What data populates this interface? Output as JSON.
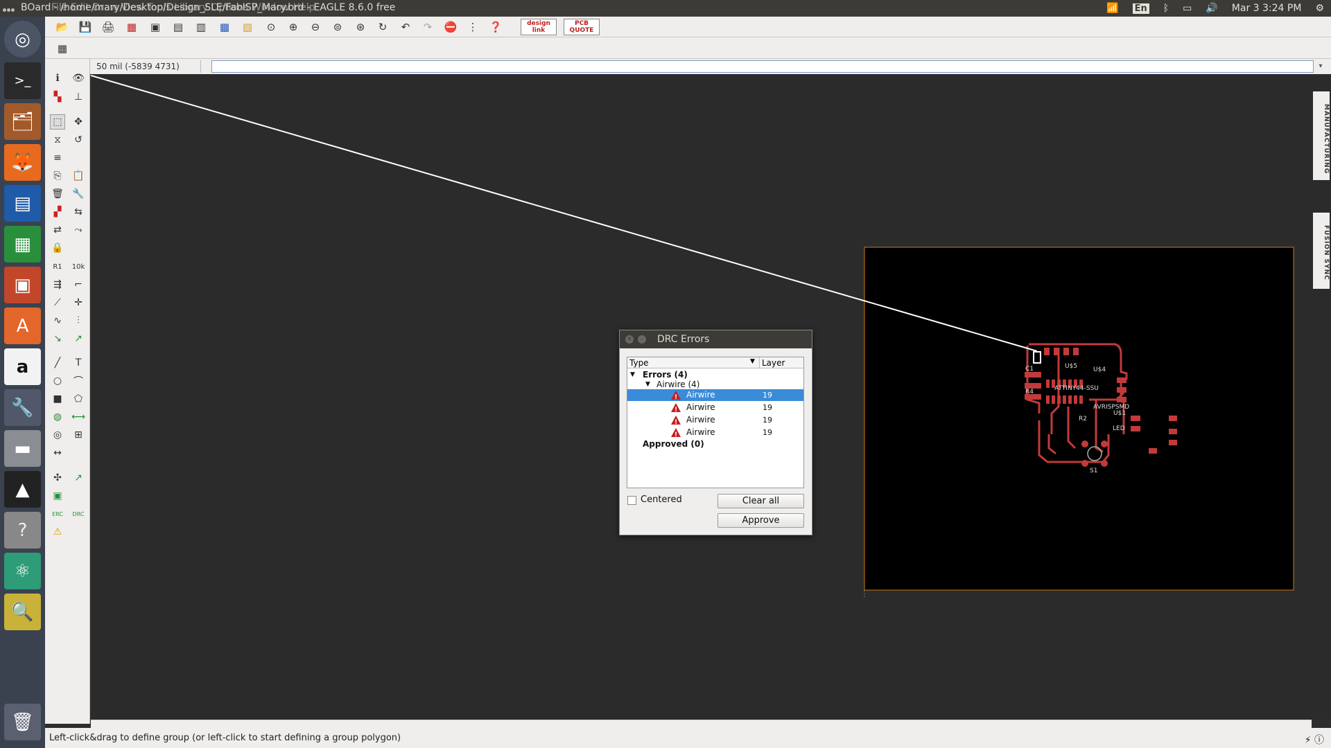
{
  "topbar": {
    "title": "BOard - /home/mary/Desktop/Design_SLE/FabISP_Mary.brd - EAGLE 8.6.0 free",
    "menus": "File  Edit  Draw  View  Tools  Library  Options  Window  Help",
    "tray": {
      "wifi_icon": "wifi-icon",
      "lang": "En",
      "bluetooth_icon": "bluetooth-icon",
      "battery_icon": "battery-icon",
      "volume_icon": "volume-icon",
      "datetime": "Mar 3  3:24 PM",
      "settings_icon": "gear-icon"
    }
  },
  "launcher": {
    "items": [
      "ubuntu-dash-icon",
      "terminal-icon",
      "files-icon",
      "firefox-icon",
      "writer-icon",
      "calc-icon",
      "impress-icon",
      "software-center-icon",
      "amazon-icon",
      "system-settings-icon",
      "disk-icon",
      "inkscape-icon",
      "help-icon",
      "atom-icon",
      "image-viewer-icon",
      "trash-icon"
    ]
  },
  "toolbar": {
    "design_link_label": "design link",
    "pcb_quote_label": "PCB QUOTE"
  },
  "command": {
    "coords": "50 mil (-5839 4731)",
    "input_value": ""
  },
  "right_tabs": {
    "manufacturing": "MANUFACTURING",
    "fusion_sync": "FUSION SYNC"
  },
  "status": {
    "message": "Left-click&drag to define group (or left-click to start defining a group polygon)"
  },
  "drc": {
    "title": "DRC Errors",
    "col_type": "Type",
    "col_layer": "Layer",
    "errors_label": "Errors (4)",
    "airwire_group": "Airwire (4)",
    "rows": [
      {
        "type": "Airwire",
        "layer": "19"
      },
      {
        "type": "Airwire",
        "layer": "19"
      },
      {
        "type": "Airwire",
        "layer": "19"
      },
      {
        "type": "Airwire",
        "layer": "19"
      }
    ],
    "approved_label": "Approved (0)",
    "centered_label": "Centered",
    "clear_all_label": "Clear all",
    "approve_label": "Approve"
  },
  "board": {
    "labels": [
      "U$5",
      "U$4",
      "C1",
      "ATTINY44-SSU",
      "AVRISPSMD",
      "R2",
      "LED",
      "S1",
      "R4",
      "U$1"
    ]
  },
  "colors": {
    "board_outline": "#d27a10",
    "copper": "#c23a3a",
    "airwire": "#ffffff",
    "selection": "#3a8bd8"
  }
}
